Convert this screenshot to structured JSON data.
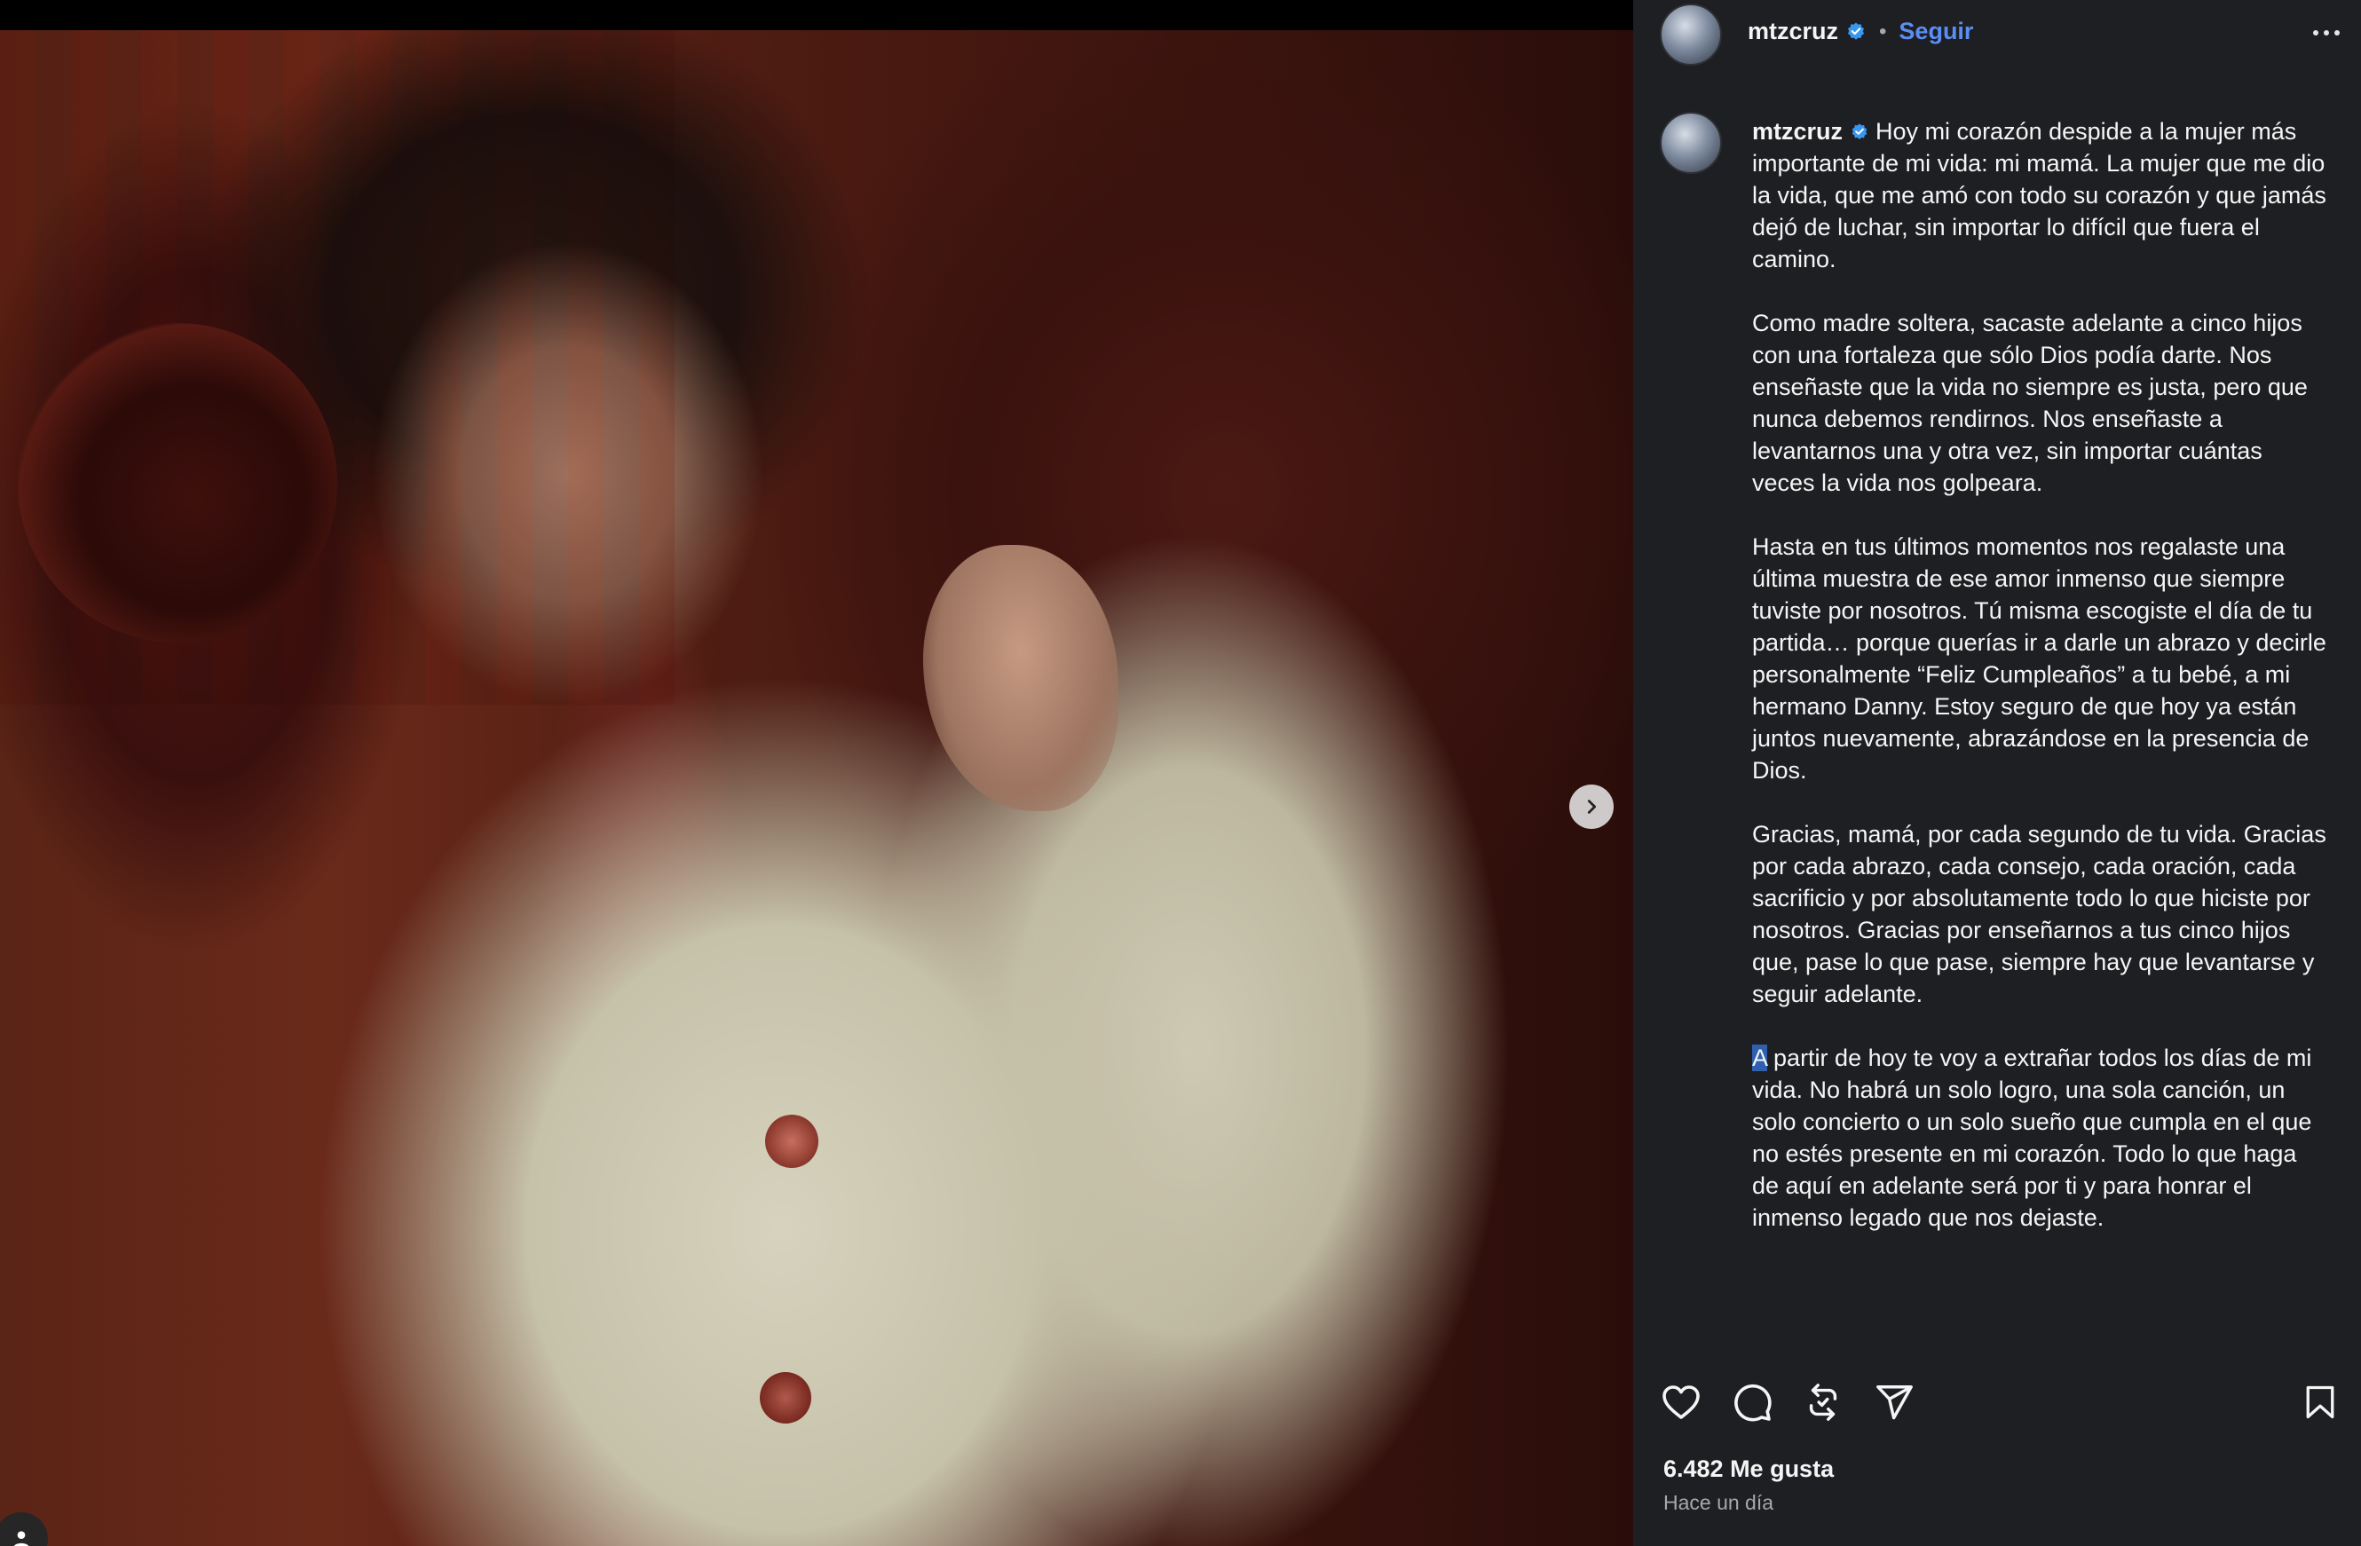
{
  "post": {
    "username": "mtzcruz",
    "separator": "•",
    "follow_label": "Seguir",
    "caption_paragraphs": [
      "Hoy mi corazón despide a la mujer más importante de mi vida: mi mamá. La mujer que me dio la vida, que me amó con todo su corazón y que jamás dejó de luchar, sin importar lo difícil que fuera el camino.",
      "Como madre soltera, sacaste adelante a cinco hijos con una fortaleza que sólo Dios podía darte. Nos enseñaste que la vida no siempre es justa, pero que nunca debemos rendirnos. Nos enseñaste a levantarnos una y otra vez, sin importar cuántas veces la vida nos golpeara.",
      "Hasta en tus últimos momentos nos regalaste una última muestra de ese amor inmenso que siempre tuviste por nosotros. Tú misma escogiste el día de tu partida… porque querías ir a darle un abrazo y decirle personalmente “Feliz Cumpleaños” a tu bebé, a mi hermano Danny. Estoy seguro de que hoy ya están juntos nuevamente, abrazándose en la presencia de Dios.",
      "Gracias, mamá, por cada segundo de tu vida. Gracias por cada abrazo, cada consejo, cada oración, cada sacrificio y por absolutamente todo lo que hiciste por nosotros. Gracias por enseñarnos a tus cinco hijos que, pase lo que pase, siempre hay que levantarse y seguir adelante."
    ],
    "last_paragraph_first_letter": "A",
    "last_paragraph_rest": " partir de hoy te voy a extrañar todos los días de mi vida. No habrá un solo logro, una sola canción, un solo concierto o un solo sueño que cumpla en el que no estés presente en mi corazón. Todo lo que haga de aquí en adelante será por ti y para honrar el inmenso legado que nos dejaste.",
    "likes": "6.482 Me gusta",
    "time": "Hace un día"
  },
  "icons": {
    "verified": "verified-badge-icon",
    "more": "more-options-icon",
    "next": "chevron-right-icon",
    "like": "heart-icon",
    "comment": "comment-icon",
    "repost": "repost-icon",
    "share": "send-icon",
    "save": "bookmark-icon",
    "tag": "user-tag-icon"
  },
  "colors": {
    "panel_bg": "#1e1f22",
    "follow": "#5b8ef5",
    "verified": "#3897f0",
    "muted": "#a8a8a8"
  }
}
